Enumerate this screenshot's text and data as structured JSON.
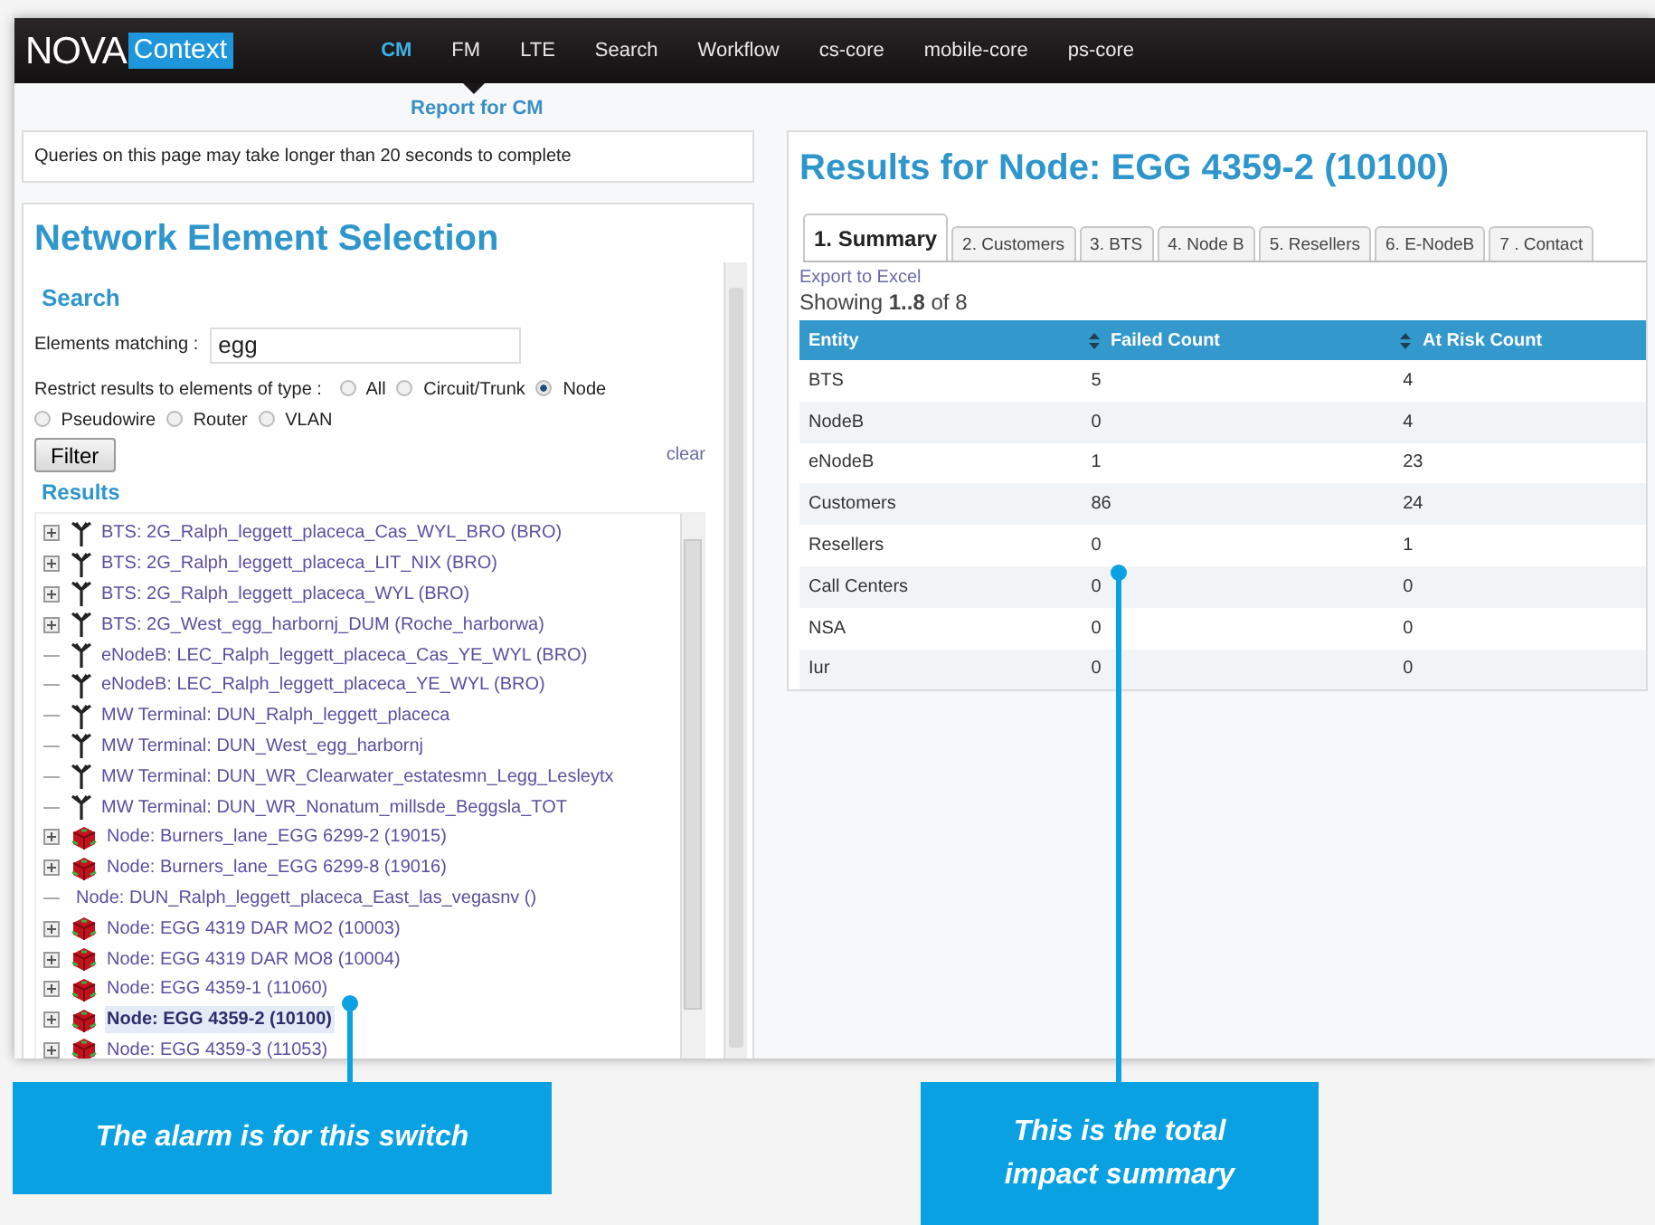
{
  "header": {
    "logo": {
      "primary": "NOVA",
      "secondary": "Context"
    },
    "nav": [
      {
        "label": "CM",
        "selected": true
      },
      {
        "label": "FM",
        "selected": false
      },
      {
        "label": "LTE",
        "selected": false
      },
      {
        "label": "Search",
        "selected": false
      },
      {
        "label": "Workflow",
        "selected": false
      },
      {
        "label": "cs-core",
        "selected": false
      },
      {
        "label": "mobile-core",
        "selected": false
      },
      {
        "label": "ps-core",
        "selected": false
      }
    ],
    "subnav": "Report for CM"
  },
  "notice": "Queries on this page may take longer than 20 seconds to complete",
  "selection": {
    "title": "Network Element Selection",
    "search_heading": "Search",
    "match_label": "Elements matching :",
    "match_value": "egg",
    "restrict_label": "Restrict results to elements of type :",
    "types": [
      {
        "label": "All",
        "selected": false
      },
      {
        "label": "Circuit/Trunk",
        "selected": false
      },
      {
        "label": "Node",
        "selected": true
      },
      {
        "label": "Pseudowire",
        "selected": false
      },
      {
        "label": "Router",
        "selected": false
      },
      {
        "label": "VLAN",
        "selected": false
      }
    ],
    "filter_button": "Filter",
    "clear_link": "clear",
    "results_heading": "Results",
    "results": [
      {
        "kind": "bts",
        "expandable": true,
        "selected": false,
        "text": "BTS: 2G_Ralph_leggett_placeca_Cas_WYL_BRO (BRO)"
      },
      {
        "kind": "bts",
        "expandable": true,
        "selected": false,
        "text": "BTS: 2G_Ralph_leggett_placeca_LIT_NIX (BRO)"
      },
      {
        "kind": "bts",
        "expandable": true,
        "selected": false,
        "text": "BTS: 2G_Ralph_leggett_placeca_WYL (BRO)"
      },
      {
        "kind": "bts",
        "expandable": true,
        "selected": false,
        "text": "BTS: 2G_West_egg_harbornj_DUM (Roche_harborwa)"
      },
      {
        "kind": "bts",
        "expandable": false,
        "selected": false,
        "text": "eNodeB: LEC_Ralph_leggett_placeca_Cas_YE_WYL (BRO)"
      },
      {
        "kind": "bts",
        "expandable": false,
        "selected": false,
        "text": "eNodeB: LEC_Ralph_leggett_placeca_YE_WYL (BRO)"
      },
      {
        "kind": "bts",
        "expandable": false,
        "selected": false,
        "text": "MW Terminal: DUN_Ralph_leggett_placeca"
      },
      {
        "kind": "bts",
        "expandable": false,
        "selected": false,
        "text": "MW Terminal: DUN_West_egg_harbornj"
      },
      {
        "kind": "bts",
        "expandable": false,
        "selected": false,
        "text": "MW Terminal: DUN_WR_Clearwater_estatesmn_Legg_Lesleytx"
      },
      {
        "kind": "bts",
        "expandable": false,
        "selected": false,
        "text": "MW Terminal: DUN_WR_Nonatum_millsde_Beggsla_TOT"
      },
      {
        "kind": "node",
        "expandable": true,
        "selected": false,
        "text": "Node: Burners_lane_EGG 6299-2 (19015)"
      },
      {
        "kind": "node",
        "expandable": true,
        "selected": false,
        "text": "Node: Burners_lane_EGG 6299-8 (19016)"
      },
      {
        "kind": "plain",
        "expandable": false,
        "selected": false,
        "text": "Node: DUN_Ralph_leggett_placeca_East_las_vegasnv ()"
      },
      {
        "kind": "node",
        "expandable": true,
        "selected": false,
        "text": "Node: EGG 4319 DAR MO2 (10003)"
      },
      {
        "kind": "node",
        "expandable": true,
        "selected": false,
        "text": "Node: EGG 4319 DAR MO8 (10004)"
      },
      {
        "kind": "node",
        "expandable": true,
        "selected": false,
        "text": "Node: EGG 4359-1 (11060)"
      },
      {
        "kind": "node",
        "expandable": true,
        "selected": true,
        "text": "Node: EGG 4359-2 (10100)"
      },
      {
        "kind": "node",
        "expandable": true,
        "selected": false,
        "text": "Node: EGG 4359-3 (11053)"
      }
    ]
  },
  "results_panel": {
    "title": "Results for Node: EGG 4359-2 (10100)",
    "tabs": [
      {
        "label": "1. Summary",
        "selected": true
      },
      {
        "label": "2. Customers",
        "selected": false
      },
      {
        "label": "3. BTS",
        "selected": false
      },
      {
        "label": "4. Node B",
        "selected": false
      },
      {
        "label": "5. Resellers",
        "selected": false
      },
      {
        "label": "6. E-NodeB",
        "selected": false
      },
      {
        "label": "7 . Contact",
        "selected": false
      }
    ],
    "export_link": "Export to Excel",
    "showing": "Showing **1..8** of 8",
    "columns": [
      "Entity",
      "Failed Count",
      "At Risk Count"
    ],
    "rows": [
      [
        "BTS",
        "5",
        "4"
      ],
      [
        "NodeB",
        "0",
        "4"
      ],
      [
        "eNodeB",
        "1",
        "23"
      ],
      [
        "Customers",
        "86",
        "24"
      ],
      [
        "Resellers",
        "0",
        "1"
      ],
      [
        "Call Centers",
        "0",
        "0"
      ],
      [
        "NSA",
        "0",
        "0"
      ],
      [
        "Iur",
        "0",
        "0"
      ]
    ]
  },
  "callouts": [
    {
      "text": "The alarm is for this switch"
    },
    {
      "text": "This is the total impact summary"
    }
  ]
}
